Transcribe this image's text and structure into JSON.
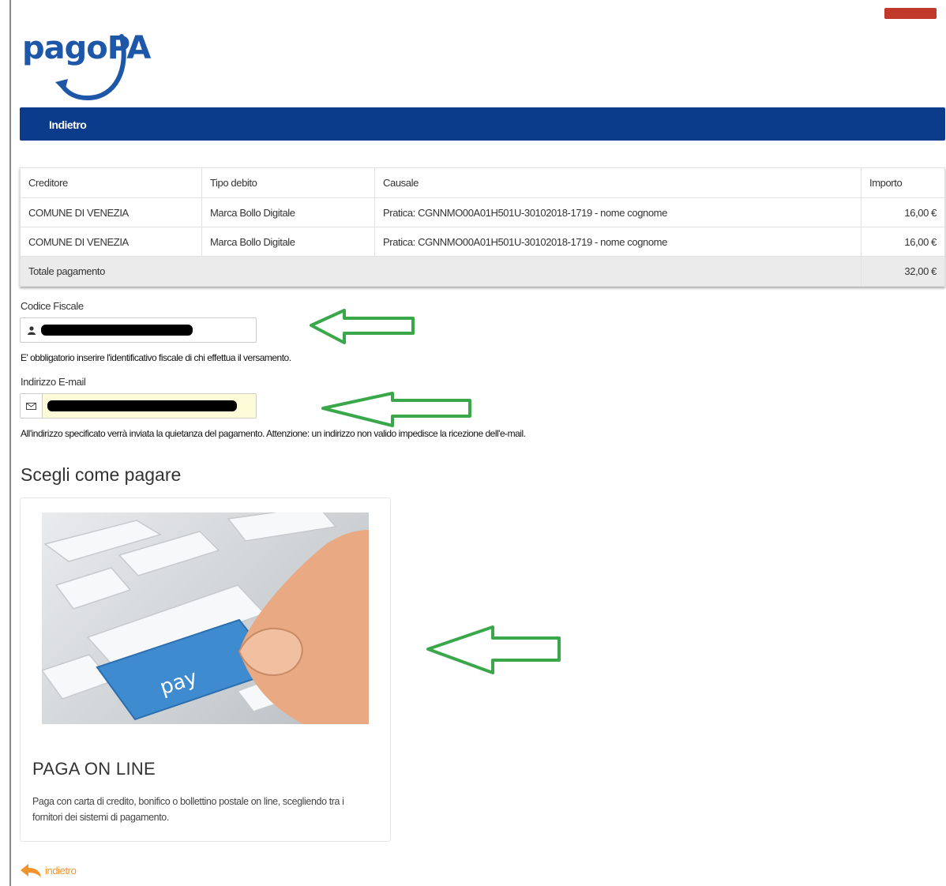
{
  "logo": {
    "text": "pagoPA"
  },
  "navbar": {
    "back_label": "Indietro"
  },
  "table": {
    "headers": [
      "Creditore",
      "Tipo debito",
      "Causale",
      "Importo"
    ],
    "rows": [
      [
        "COMUNE DI VENEZIA",
        "Marca Bollo Digitale",
        "Pratica: CGNNMO00A01H501U-30102018-1719 - nome cognome",
        "16,00 €"
      ],
      [
        "COMUNE DI VENEZIA",
        "Marca Bollo Digitale",
        "Pratica: CGNNMO00A01H501U-30102018-1719 - nome cognome",
        "16,00 €"
      ]
    ],
    "total_label": "Totale pagamento",
    "total_value": "32,00 €"
  },
  "form": {
    "codice_fiscale_label": "Codice Fiscale",
    "codice_fiscale_help": "E' obbligatorio inserire l'identificativo fiscale di chi effettua il versamento.",
    "email_label": "Indirizzo E-mail",
    "email_help": "All'indirizzo specificato verrà inviata la quietanza del pagamento. Attenzione: un indirizzo non valido impedisce la ricezione dell'e-mail."
  },
  "payment": {
    "section_title": "Scegli come pagare",
    "card_title": "PAGA ON LINE",
    "card_desc": "Paga con carta di credito, bonifico o bollettino postale on line, scegliendo tra i fornitori dei sistemi di pagamento.",
    "key_label": "pay"
  },
  "footer": {
    "back_label": "indietro"
  },
  "colors": {
    "navbar": "#0b3c8c",
    "logo": "#1e57a8",
    "arrows": "#3aa84a",
    "back_link": "#f0932b"
  }
}
